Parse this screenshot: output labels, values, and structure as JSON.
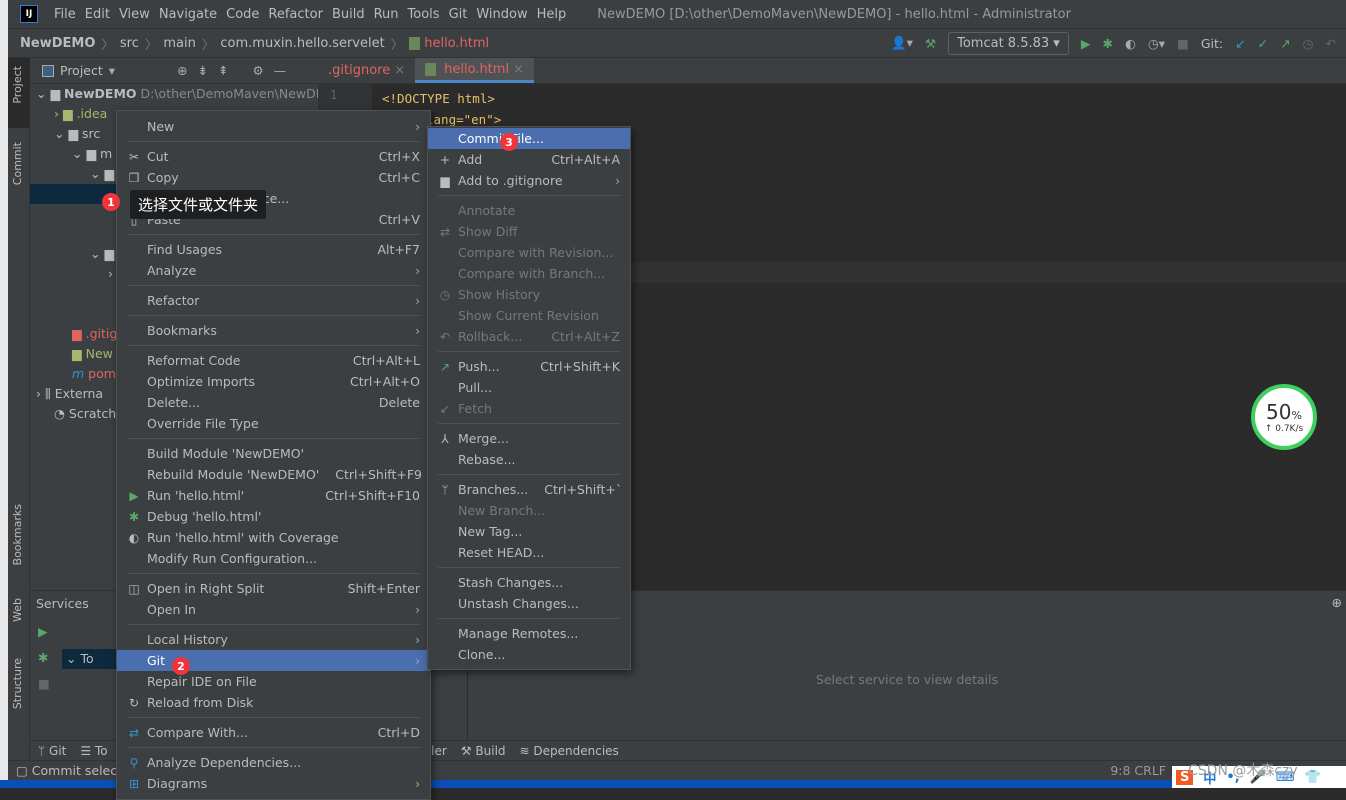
{
  "title_bar": {
    "menus": [
      "File",
      "Edit",
      "View",
      "Navigate",
      "Code",
      "Refactor",
      "Build",
      "Run",
      "Tools",
      "Git",
      "Window",
      "Help"
    ],
    "window_title": "NewDEMO [D:\\other\\DemoMaven\\NewDEMO] - hello.html - Administrator"
  },
  "breadcrumb": [
    "NewDEMO",
    "src",
    "main",
    "com.muxin.hello.servelet",
    "hello.html"
  ],
  "toolbar": {
    "run_config": "Tomcat 8.5.83",
    "git_label": "Git:"
  },
  "sidebar_left": [
    "Project",
    "Commit",
    "Bookmarks",
    "Web",
    "Structure"
  ],
  "project": {
    "header": "Project",
    "root": "NewDEMO",
    "root_path": "D:\\other\\DemoMaven\\NewDE",
    "tree": [
      ".idea",
      "src",
      "m",
      "",
      ".gitig",
      "New",
      "pom",
      "Externa",
      "Scratch"
    ]
  },
  "tabs": [
    {
      "label": ".gitignore"
    },
    {
      "label": "hello.html",
      "active": true
    }
  ],
  "editor": {
    "line": "1",
    "code": [
      "<!DOCTYPE html>",
      "lang=\"en\">"
    ]
  },
  "context_menu": [
    {
      "label": "New",
      "submenu": true
    },
    {
      "sep": true
    },
    {
      "label": "Cut",
      "shortcut": "Ctrl+X",
      "icon": "scissors"
    },
    {
      "label": "Copy",
      "shortcut": "Ctrl+C",
      "icon": "copy"
    },
    {
      "label": "Copy Path/Reference..."
    },
    {
      "label": "Paste",
      "shortcut": "Ctrl+V",
      "icon": "clipboard"
    },
    {
      "sep": true
    },
    {
      "label": "Find Usages",
      "shortcut": "Alt+F7"
    },
    {
      "label": "Analyze",
      "submenu": true
    },
    {
      "sep": true
    },
    {
      "label": "Refactor",
      "submenu": true
    },
    {
      "sep": true
    },
    {
      "label": "Bookmarks",
      "submenu": true
    },
    {
      "sep": true
    },
    {
      "label": "Reformat Code",
      "shortcut": "Ctrl+Alt+L"
    },
    {
      "label": "Optimize Imports",
      "shortcut": "Ctrl+Alt+O"
    },
    {
      "label": "Delete...",
      "shortcut": "Delete"
    },
    {
      "label": "Override File Type"
    },
    {
      "sep": true
    },
    {
      "label": "Build Module 'NewDEMO'"
    },
    {
      "label": "Rebuild Module 'NewDEMO'",
      "shortcut": "Ctrl+Shift+F9"
    },
    {
      "label": "Run 'hello.html'",
      "shortcut": "Ctrl+Shift+F10",
      "icon": "run"
    },
    {
      "label": "Debug 'hello.html'",
      "icon": "debug"
    },
    {
      "label": "Run 'hello.html' with Coverage",
      "icon": "coverage"
    },
    {
      "label": "Modify Run Configuration..."
    },
    {
      "sep": true
    },
    {
      "label": "Open in Right Split",
      "shortcut": "Shift+Enter",
      "icon": "split"
    },
    {
      "label": "Open In",
      "submenu": true
    },
    {
      "sep": true
    },
    {
      "label": "Local History",
      "submenu": true
    },
    {
      "label": "Git",
      "submenu": true,
      "selected": true
    },
    {
      "label": "Repair IDE on File"
    },
    {
      "label": "Reload from Disk",
      "icon": "reload"
    },
    {
      "sep": true
    },
    {
      "label": "Compare With...",
      "shortcut": "Ctrl+D",
      "icon": "compare"
    },
    {
      "sep": true
    },
    {
      "label": "Analyze Dependencies...",
      "icon": "analyze"
    },
    {
      "label": "Diagrams",
      "submenu": true,
      "icon": "diagram"
    }
  ],
  "git_submenu": [
    {
      "label": "Commit File...",
      "selected": true
    },
    {
      "label": "Add",
      "shortcut": "Ctrl+Alt+A",
      "icon": "plus"
    },
    {
      "label": "Add to .gitignore",
      "submenu": true,
      "icon": "gitignore"
    },
    {
      "sep": true
    },
    {
      "label": "Annotate",
      "disabled": true
    },
    {
      "label": "Show Diff",
      "disabled": true,
      "icon": "diff"
    },
    {
      "label": "Compare with Revision...",
      "disabled": true
    },
    {
      "label": "Compare with Branch...",
      "disabled": true
    },
    {
      "label": "Show History",
      "disabled": true,
      "icon": "clock"
    },
    {
      "label": "Show Current Revision",
      "disabled": true
    },
    {
      "label": "Rollback...",
      "shortcut": "Ctrl+Alt+Z",
      "disabled": true,
      "icon": "undo"
    },
    {
      "sep": true
    },
    {
      "label": "Push...",
      "shortcut": "Ctrl+Shift+K",
      "icon": "push"
    },
    {
      "label": "Pull..."
    },
    {
      "label": "Fetch",
      "disabled": true,
      "icon": "fetch"
    },
    {
      "sep": true
    },
    {
      "label": "Merge...",
      "icon": "merge"
    },
    {
      "label": "Rebase..."
    },
    {
      "sep": true
    },
    {
      "label": "Branches...",
      "shortcut": "Ctrl+Shift+`",
      "icon": "branch"
    },
    {
      "label": "New Branch...",
      "disabled": true
    },
    {
      "label": "New Tag..."
    },
    {
      "label": "Reset HEAD..."
    },
    {
      "sep": true
    },
    {
      "label": "Stash Changes..."
    },
    {
      "label": "Unstash Changes..."
    },
    {
      "sep": true
    },
    {
      "label": "Manage Remotes..."
    },
    {
      "label": "Clone..."
    }
  ],
  "annotations": {
    "tip": "选择文件或文件夹",
    "badge1": "1",
    "badge2": "2",
    "badge3": "3"
  },
  "services": {
    "title": "Services",
    "tree_item": "To",
    "placeholder": "Select service to view details"
  },
  "bottom_tools": [
    "Git",
    "To",
    "rofiler",
    "Build",
    "Dependencies"
  ],
  "status": {
    "text": "Commit selec",
    "right": "9:8  CRLF"
  },
  "watermark": "CSDN @木森czy",
  "net_gauge": {
    "percent": "50",
    "unit": "%",
    "speed": "0.7K/s"
  },
  "ime": [
    "S",
    "中",
    "•,",
    "🎤",
    "⌨",
    "👕"
  ]
}
